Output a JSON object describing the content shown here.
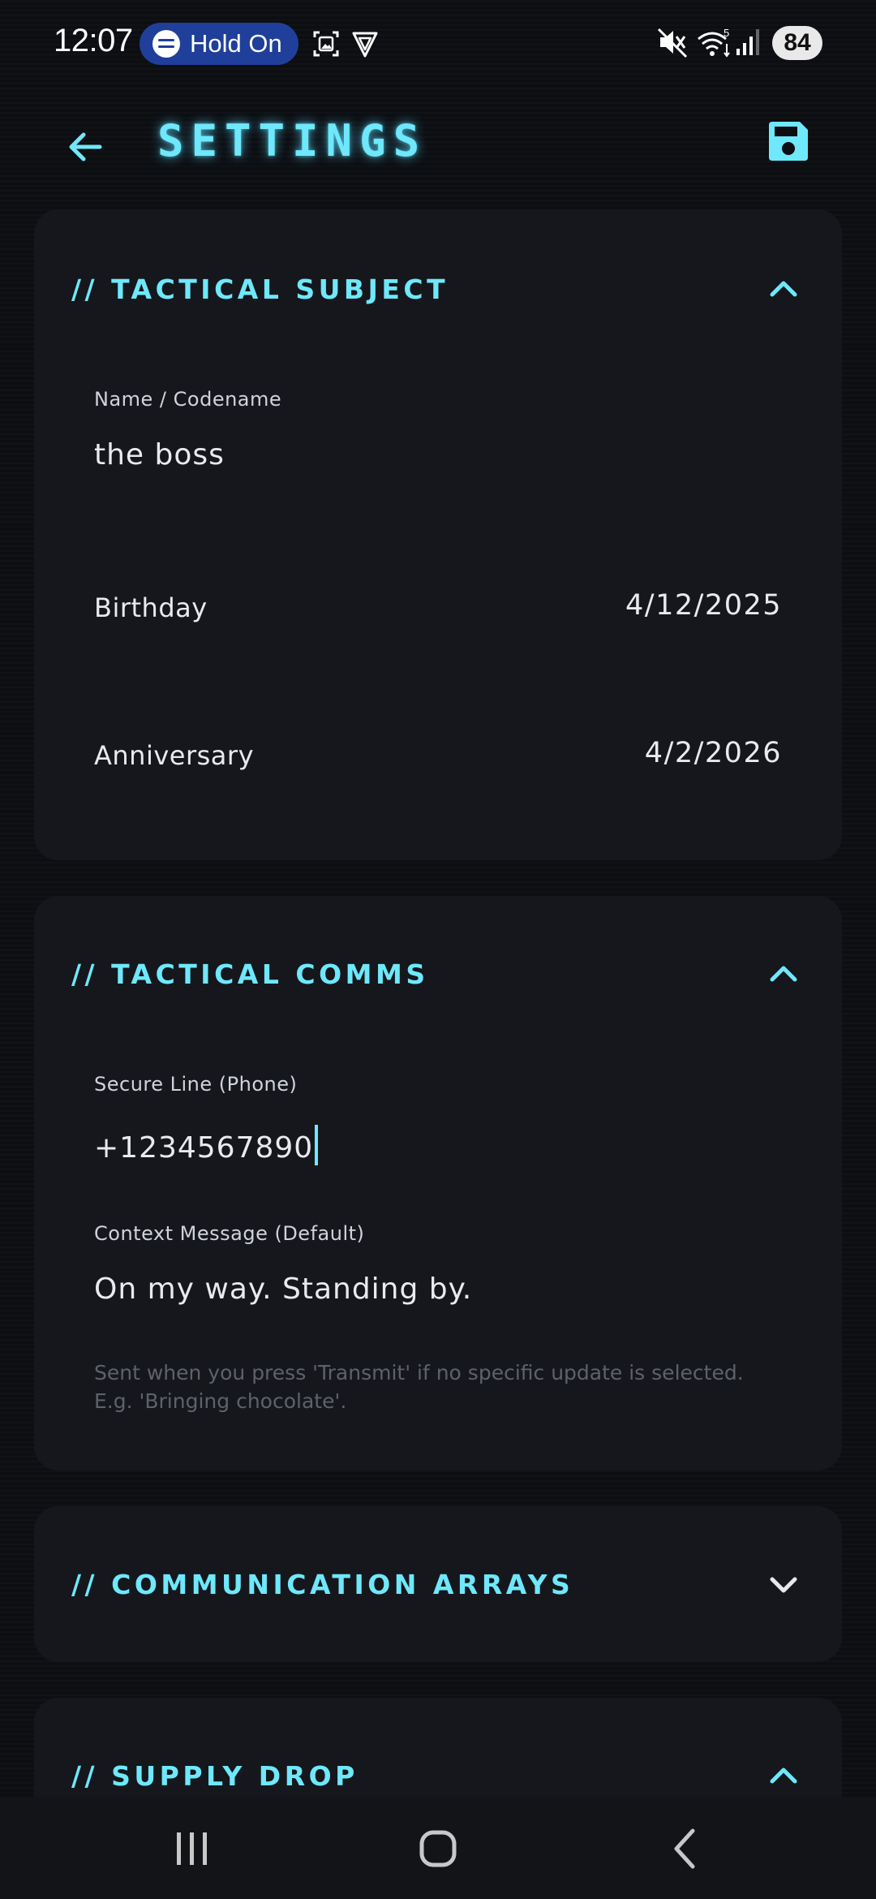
{
  "status_bar": {
    "time": "12:07",
    "media_pill_text": "Hold On",
    "battery": "84",
    "icons": [
      "spotify-icon",
      "screenshot-icon",
      "vpn-shield-icon",
      "mute-icon",
      "wifi-icon",
      "signal-icon"
    ]
  },
  "app_bar": {
    "title": "SETTINGS",
    "back_icon": "arrow-left-icon",
    "save_icon": "floppy-disk-icon"
  },
  "colors": {
    "accent": "#6ee8fa",
    "card_bg": "#15171c",
    "page_bg": "#0c0e12",
    "hint": "#5d626a"
  },
  "sections": {
    "tactical_subject": {
      "title": "// TACTICAL SUBJECT",
      "expanded": true,
      "name_label": "Name / Codename",
      "name_value": "the boss",
      "birthday_label": "Birthday",
      "birthday_value": "4/12/2025",
      "anniversary_label": "Anniversary",
      "anniversary_value": "4/2/2026"
    },
    "tactical_comms": {
      "title": "// TACTICAL COMMS",
      "expanded": true,
      "phone_label": "Secure Line (Phone)",
      "phone_value": "+1234567890",
      "message_label": "Context Message (Default)",
      "message_value": "On my way. Standing by.",
      "helper_line1": "Sent when you press 'Transmit' if no specific update is selected.",
      "helper_line2": "E.g. 'Bringing chocolate'."
    },
    "communication_arrays": {
      "title": "// COMMUNICATION ARRAYS",
      "expanded": false
    },
    "supply_drop": {
      "title": "// SUPPLY DROP",
      "expanded": true
    }
  },
  "nav_bar": {
    "icons": [
      "recents-icon",
      "home-icon",
      "back-icon"
    ]
  }
}
